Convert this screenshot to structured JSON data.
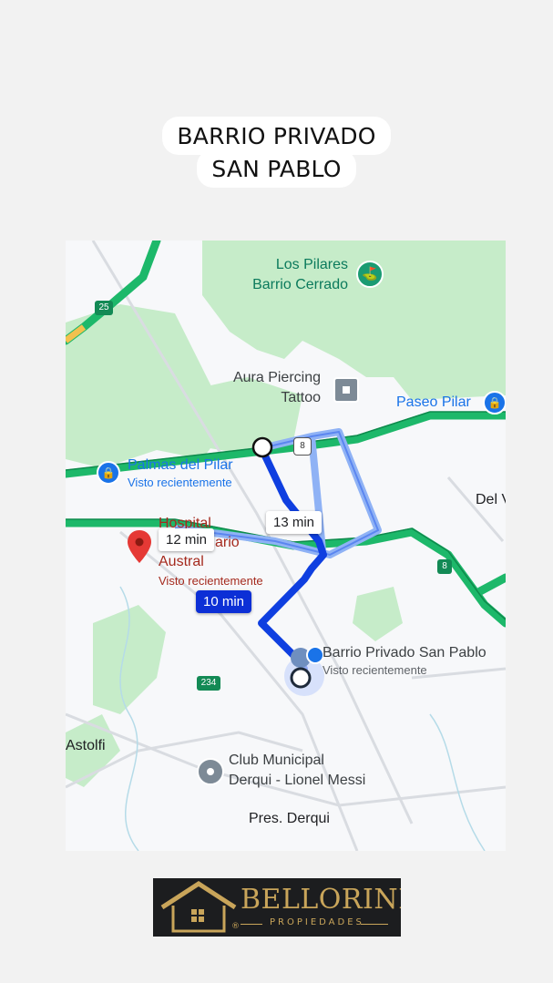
{
  "header": {
    "title_line1": "BARRIO PRIVADO",
    "title_line2": "SAN PABLO"
  },
  "map": {
    "places": {
      "los_pilares_line1": "Los Pilares",
      "los_pilares_line2": "Barrio Cerrado",
      "aura_line1": "Aura Piercing",
      "aura_line2": "Tattoo",
      "paseo_pilar": "Paseo Pilar",
      "palmas": "Palmas del Pilar",
      "palmas_sub": "Visto recientemente",
      "del_v": "Del V",
      "hospital_line1": "Hospital",
      "hospital_line2": "ario",
      "hospital_line3": "Austral",
      "hospital_sub": "Visto recientemente",
      "san_pablo": "Barrio Privado San Pablo",
      "san_pablo_sub": "Visto recientemente",
      "astolfi": "Astolfi",
      "club_line1": "Club Municipal",
      "club_line2": "Derqui - Lionel Messi",
      "pres_derqui": "Pres. Derqui"
    },
    "route_shields": {
      "r25": "25",
      "r8a": "8",
      "r8b": "8",
      "r234": "234"
    },
    "route_times": {
      "alt1": "13 min",
      "alt2": "12 min",
      "selected": "10 min"
    },
    "colors": {
      "highway": "#1db86a",
      "route_selected": "#0f3fe0",
      "route_alt": "#8fb2f5",
      "park": "#c6ecc9",
      "poi_red": "#a52a1e",
      "poi_teal": "#1a8c6b",
      "poi_blue": "#1a73e8"
    }
  },
  "logo": {
    "brand": "BELLORINI",
    "subtitle": "PROPIEDADES",
    "registered": "®"
  }
}
